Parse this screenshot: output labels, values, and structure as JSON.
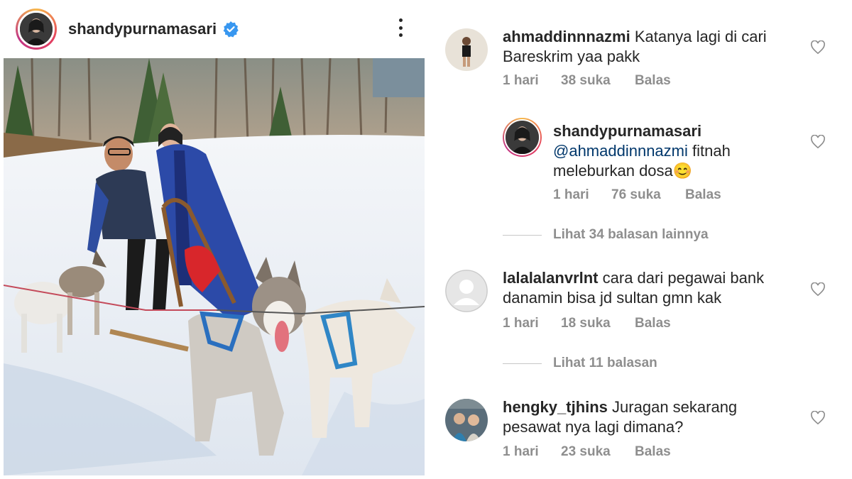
{
  "post": {
    "username": "shandypurnamasari",
    "verified_icon": "verified-badge-icon",
    "more_icon": "more-options-icon"
  },
  "colors": {
    "accent_blue": "#3897f0",
    "mention": "#00376b",
    "meta_gray": "#8e8e8e",
    "text": "#262626"
  },
  "comments": [
    {
      "username": "ahmaddinnnazmi",
      "text": "Katanya lagi di cari",
      "text2": "Bareskrim yaa pakk",
      "time": "1 hari",
      "likes": "38 suka",
      "reply": "Balas"
    },
    {
      "username": "shandypurnamasari",
      "mention": "@ahmaddinnnazmi",
      "text": "fitnah",
      "text2": "meleburkan dosa",
      "emoji": "😊",
      "time": "1 hari",
      "likes": "76 suka",
      "reply": "Balas"
    },
    {
      "username": "lalalalanvrlnt",
      "text": "cara dari pegawai bank",
      "text2": "danamin bisa jd sultan gmn kak",
      "time": "1 hari",
      "likes": "18 suka",
      "reply": "Balas"
    },
    {
      "username": "hengky_tjhins",
      "text": "Juragan sekarang",
      "text2": "pesawat nya lagi dimana?",
      "time": "1 hari",
      "likes": "23 suka",
      "reply": "Balas"
    }
  ],
  "view_replies": [
    {
      "label": "Lihat 34 balasan lainnya"
    },
    {
      "label": "Lihat 11 balasan"
    }
  ]
}
